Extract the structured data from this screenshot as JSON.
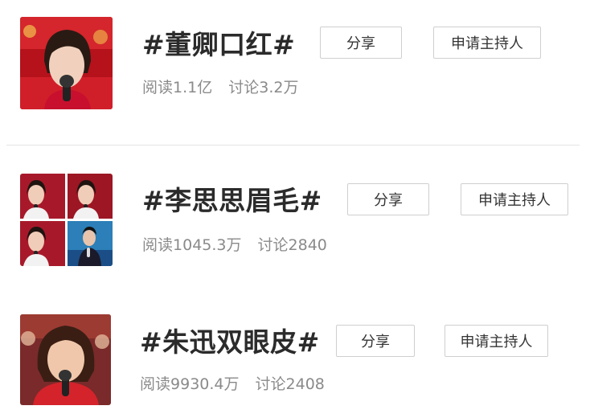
{
  "topics": [
    {
      "title": "#董卿口红#",
      "share_label": "分享",
      "host_label": "申请主持人",
      "read_label": "阅读",
      "read_count": "1.1亿",
      "discuss_label": "讨论",
      "discuss_count": "3.2万"
    },
    {
      "title": "#李思思眉毛#",
      "share_label": "分享",
      "host_label": "申请主持人",
      "read_label": "阅读",
      "read_count": "1045.3万",
      "discuss_label": "讨论",
      "discuss_count": "2840"
    },
    {
      "title": "#朱迅双眼皮#",
      "share_label": "分享",
      "host_label": "申请主持人",
      "read_label": "阅读",
      "read_count": "9930.4万",
      "discuss_label": "讨论",
      "discuss_count": "2408"
    }
  ],
  "colors": {
    "title": "#2b2b2b",
    "stats": "#8a8a8a",
    "button_border": "#cfcfcf",
    "thumb_red": "#c8102e"
  }
}
